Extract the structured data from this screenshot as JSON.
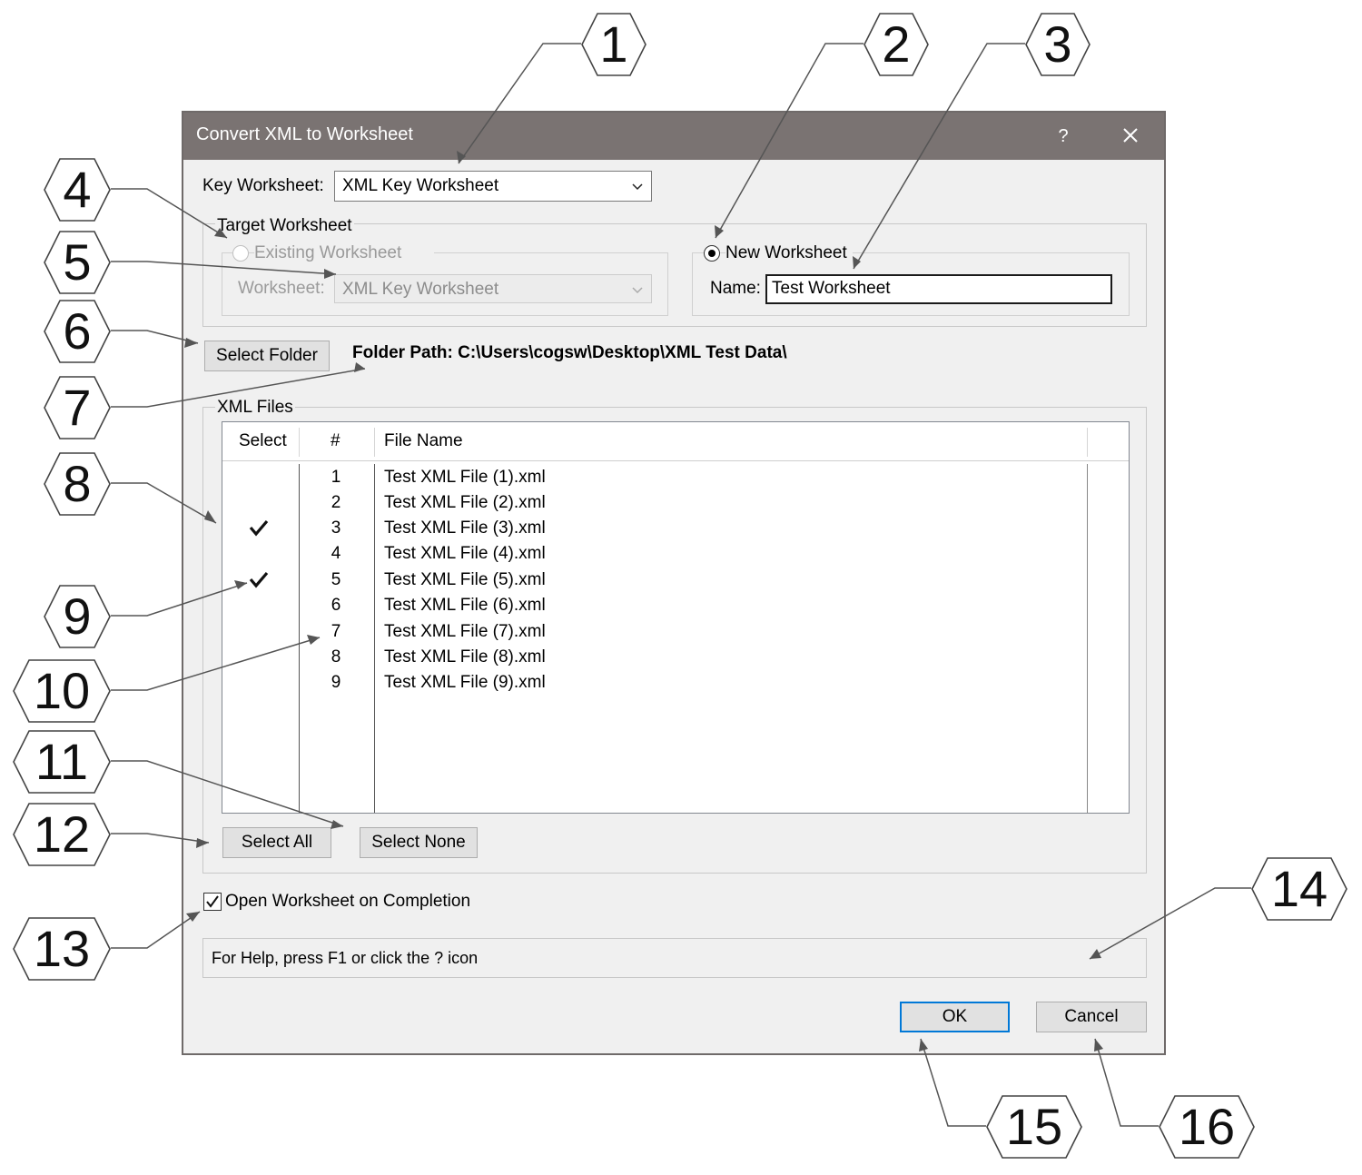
{
  "dialog": {
    "title": "Convert XML to Worksheet",
    "help_glyph": "?",
    "key_worksheet": {
      "label": "Key Worksheet:",
      "value": "XML Key Worksheet"
    },
    "target_group": {
      "legend": "Target Worksheet",
      "existing": {
        "label": "Existing Worksheet",
        "selected": false,
        "worksheet_label": "Worksheet:",
        "worksheet_value": "XML Key Worksheet"
      },
      "new": {
        "label": "New Worksheet",
        "selected": true,
        "name_label": "Name:",
        "name_value": "Test Worksheet"
      }
    },
    "select_folder_label": "Select Folder",
    "folder_path": "Folder Path:  C:\\Users\\cogsw\\Desktop\\XML Test Data\\",
    "xml_files": {
      "legend": "XML Files",
      "columns": [
        "Select",
        "#",
        "File Name"
      ],
      "rows": [
        {
          "num": "1",
          "name": "Test XML File (1).xml",
          "selected": false
        },
        {
          "num": "2",
          "name": "Test XML File (2).xml",
          "selected": false
        },
        {
          "num": "3",
          "name": "Test XML File (3).xml",
          "selected": true
        },
        {
          "num": "4",
          "name": "Test XML File (4).xml",
          "selected": false
        },
        {
          "num": "5",
          "name": "Test XML File (5).xml",
          "selected": true
        },
        {
          "num": "6",
          "name": "Test XML File (6).xml",
          "selected": false
        },
        {
          "num": "7",
          "name": "Test XML File (7).xml",
          "selected": false
        },
        {
          "num": "8",
          "name": "Test XML File (8).xml",
          "selected": false
        },
        {
          "num": "9",
          "name": "Test XML File (9).xml",
          "selected": false
        }
      ],
      "select_all_label": "Select All",
      "select_none_label": "Select None"
    },
    "open_on_completion": {
      "label": "Open Worksheet on Completion",
      "checked": true
    },
    "status_text": "For Help, press F1 or click the ? icon",
    "ok_label": "OK",
    "cancel_label": "Cancel",
    "accent_color": "#0078d7",
    "titlebar_color": "#7a7372"
  },
  "callouts": [
    "1",
    "2",
    "3",
    "4",
    "5",
    "6",
    "7",
    "8",
    "9",
    "10",
    "11",
    "12",
    "13",
    "14",
    "15",
    "16"
  ]
}
